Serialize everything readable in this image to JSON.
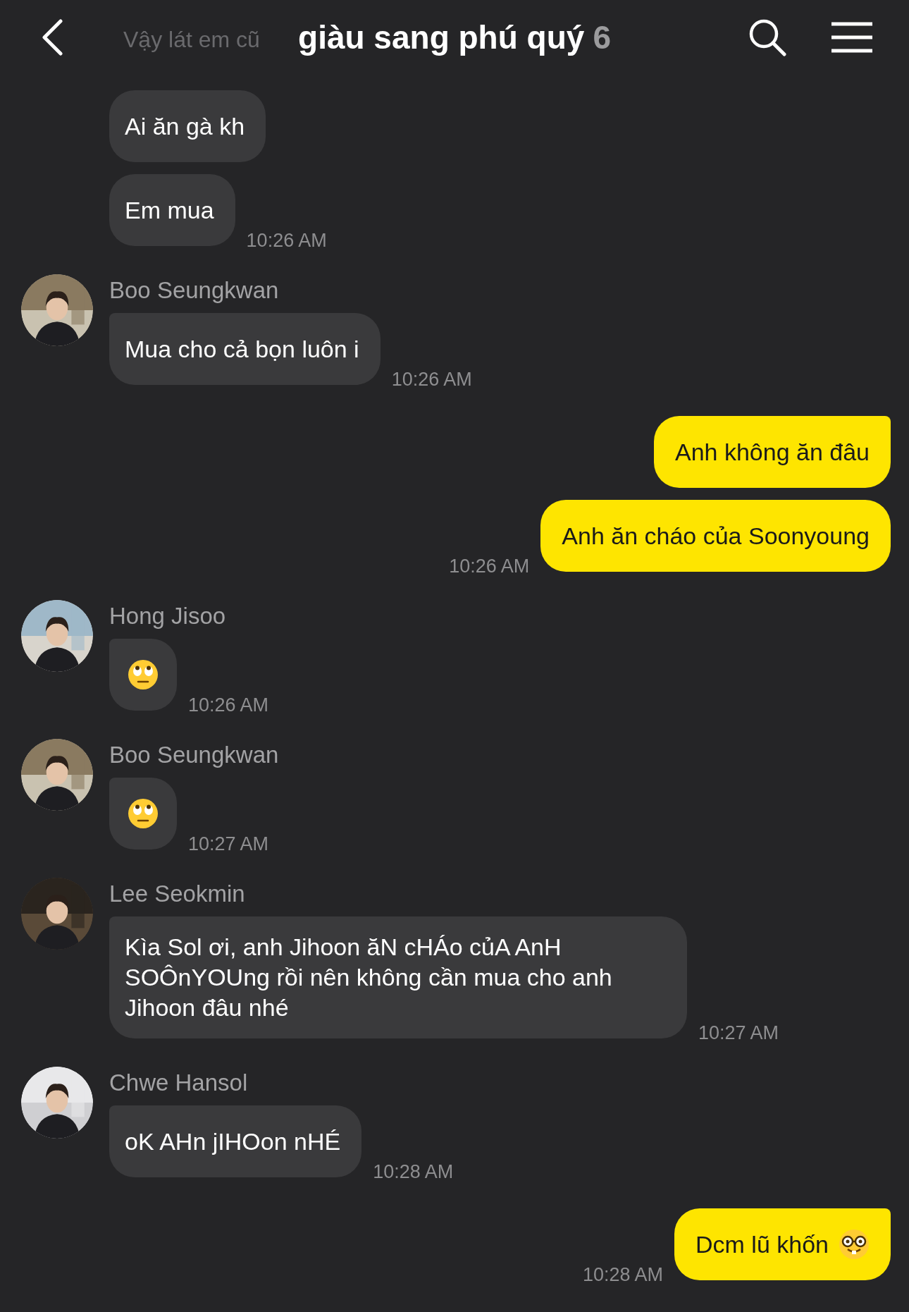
{
  "header": {
    "title": "giàu sang phú quý",
    "member_count": "6",
    "preview_text": "Vậy lát em cũ"
  },
  "groups": [
    {
      "kind": "received",
      "messages": [
        {
          "kind": "text",
          "text": "Ai ăn gà kh"
        },
        {
          "kind": "text",
          "text": "Em mua"
        }
      ],
      "time": "10:26 AM"
    },
    {
      "kind": "received",
      "sender": "Boo Seungkwan",
      "messages": [
        {
          "kind": "text",
          "text": "Mua cho cả bọn luôn i"
        }
      ],
      "time": "10:26 AM"
    },
    {
      "kind": "sent",
      "messages": [
        {
          "kind": "text",
          "text": "Anh không ăn đâu"
        },
        {
          "kind": "text",
          "text": "Anh ăn cháo của Soonyoung"
        }
      ],
      "time": "10:26 AM"
    },
    {
      "kind": "received",
      "sender": "Hong Jisoo",
      "messages": [
        {
          "kind": "emoji"
        }
      ],
      "time": "10:26 AM"
    },
    {
      "kind": "received",
      "sender": "Boo Seungkwan",
      "messages": [
        {
          "kind": "emoji"
        }
      ],
      "time": "10:27 AM"
    },
    {
      "kind": "received",
      "sender": "Lee Seokmin",
      "messages": [
        {
          "kind": "text",
          "text": "Kìa Sol ơi, anh Jihoon ăN cHÁo củA AnH SOÔnYOUng rồi nên không cần mua cho anh Jihoon đâu nhé"
        }
      ],
      "time": "10:27 AM"
    },
    {
      "kind": "received",
      "sender": "Chwe Hansol",
      "messages": [
        {
          "kind": "text",
          "text": "oK AHn jIHOon nHÉ"
        }
      ],
      "time": "10:28 AM"
    },
    {
      "kind": "sent",
      "messages": [
        {
          "kind": "text_emoji",
          "text": "Dcm lũ khốn"
        }
      ],
      "time": "10:28 AM"
    }
  ]
}
